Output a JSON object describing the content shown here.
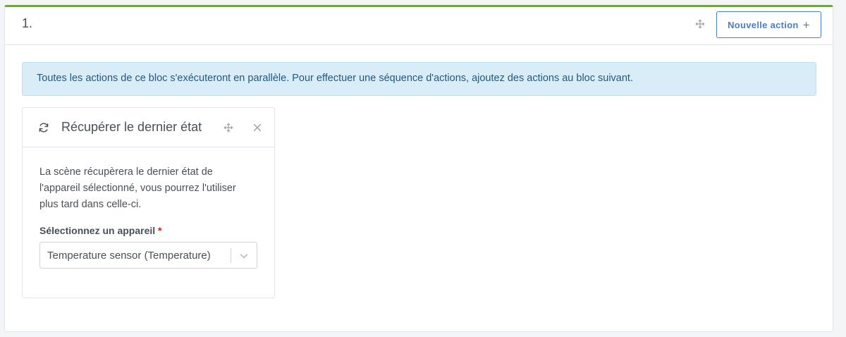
{
  "block": {
    "number": "1.",
    "new_action_label": "Nouvelle action",
    "new_action_icon": "plus-icon",
    "accent_color": "#5eba00",
    "info_text": "Toutes les actions de ce bloc s'exécuteront en parallèle. Pour effectuer une séquence d'actions, ajoutez des actions au bloc suivant."
  },
  "action_card": {
    "icon": "refresh-icon",
    "title": "Récupérer le dernier état",
    "description_lines": [
      "La scène récupèrera le dernier état de",
      "l'appareil sélectionné, vous pourrez l'utiliser",
      "plus tard dans celle-ci."
    ],
    "field_label": "Sélectionnez un appareil",
    "required_marker": "*",
    "selected_device": "Temperature sensor (Temperature)"
  }
}
